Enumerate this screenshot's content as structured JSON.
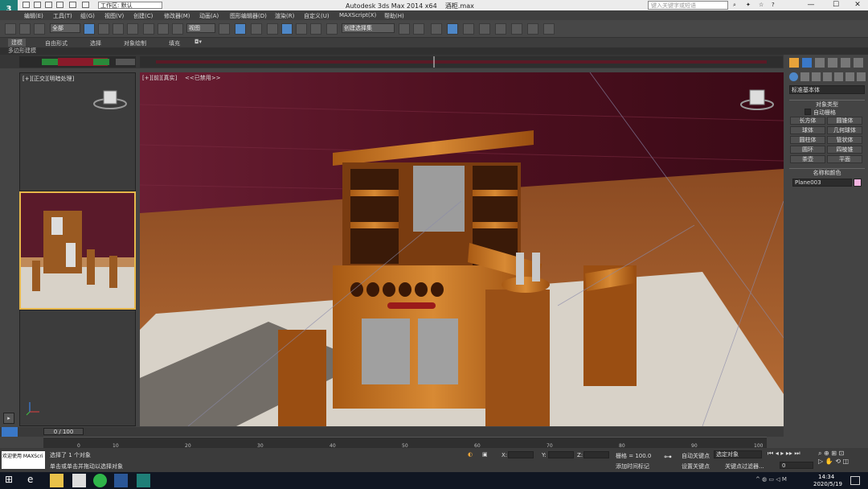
{
  "window": {
    "app_title": "Autodesk 3ds Max  2014 x64",
    "file_name": "酒柜.max",
    "workspace": "工作区: 默认",
    "search_placeholder": "键入关键字或短语",
    "minimize": "—",
    "maximize": "☐",
    "close": "✕"
  },
  "menus": [
    "编辑(E)",
    "工具(T)",
    "组(G)",
    "视图(V)",
    "创建(C)",
    "修改器(M)",
    "动画(A)",
    "图形编辑器(D)",
    "渲染(R)",
    "自定义(U)",
    "MAXScript(X)",
    "帮助(H)"
  ],
  "toolbar": {
    "selection_filter": "全部",
    "ref_coord": "视图",
    "named_selection": "创建选择集"
  },
  "ribbon": {
    "tabs": [
      "建模",
      "自由形式",
      "选择",
      "对象绘制",
      "填充"
    ],
    "active_tab": "建模"
  },
  "mode_label": "多边形建模",
  "viewports": {
    "left_label": "[+][正交][明暗处理]",
    "main_label": "[+][前][真实]",
    "main_sub_label": "<<已禁用>>"
  },
  "cmd_panel": {
    "category": "标准基本体",
    "object_type_header": "对象类型",
    "autogrid_label": "自动栅格",
    "buttons": [
      "长方体",
      "圆锥体",
      "球体",
      "几何球体",
      "圆柱体",
      "管状体",
      "圆环",
      "四棱锥",
      "茶壶",
      "平面"
    ],
    "name_color_header": "名称和颜色",
    "object_name": "Plane003",
    "object_color": "#f3b3e0"
  },
  "timeline": {
    "frame_counter": "0 / 100",
    "ticks": [
      "0",
      "5",
      "10",
      "15",
      "20",
      "25",
      "30",
      "35",
      "40",
      "45",
      "50",
      "55",
      "60",
      "65",
      "70",
      "75",
      "80",
      "85",
      "90",
      "95",
      "100"
    ]
  },
  "status": {
    "maxscript_line1": "欢迎使用 MAXScri",
    "selected_text": "选择了 1 个对象",
    "prompt_text": "单击或单击并拖动以选择对象",
    "x_label": "X:",
    "y_label": "Y:",
    "z_label": "Z:",
    "grid_text": "栅格 = 100.0",
    "autokey_label": "自动关键点",
    "setkey_label": "设置关键点",
    "selection_set": "选定对象",
    "key_filter": "关键点过滤器...",
    "add_time_tag": "添加时间标记",
    "frame_field": "0"
  },
  "taskbar": {
    "time": "14:34",
    "date": "2020/5/19"
  }
}
